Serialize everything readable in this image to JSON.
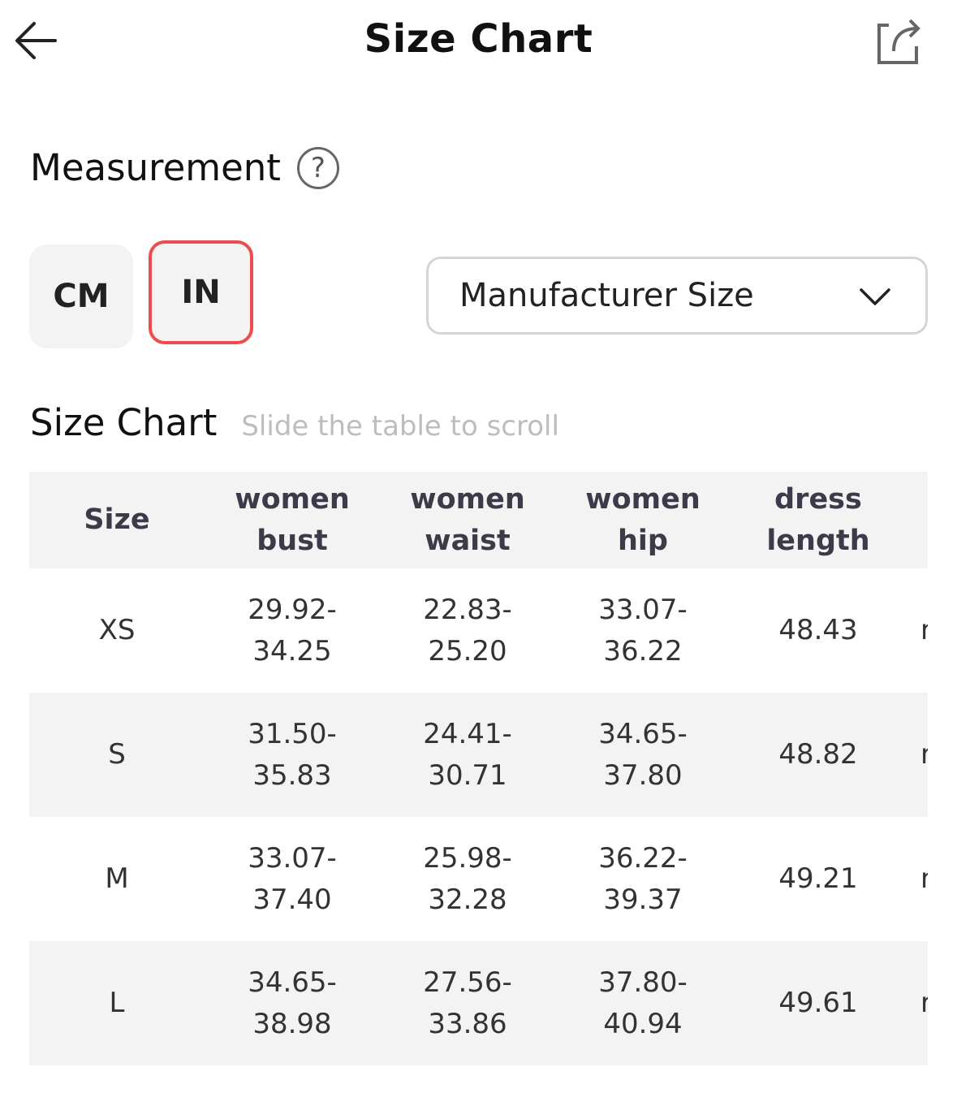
{
  "header": {
    "title": "Size Chart",
    "back_icon": "arrow-left-icon",
    "share_icon": "share-icon"
  },
  "measurement": {
    "title": "Measurement",
    "help_icon": "question-circle-icon",
    "help_glyph": "?",
    "units": [
      "CM",
      "IN"
    ],
    "selected_unit": "IN",
    "accent_color": "#ee4b4f"
  },
  "dropdown": {
    "value": "Manufacturer Size",
    "icon": "chevron-down-icon"
  },
  "size_chart": {
    "title": "Size Chart",
    "hint": "Slide the table to scroll",
    "columns": [
      "Size",
      "women\nbust",
      "women\nwaist",
      "women\nhip",
      "dress\nlength",
      ""
    ],
    "rows": [
      [
        "XS",
        "29.92-\n34.25",
        "22.83-\n25.20",
        "33.07-\n36.22",
        "48.43",
        "r"
      ],
      [
        "S",
        "31.50-\n35.83",
        "24.41-\n30.71",
        "34.65-\n37.80",
        "48.82",
        "r"
      ],
      [
        "M",
        "33.07-\n37.40",
        "25.98-\n32.28",
        "36.22-\n39.37",
        "49.21",
        "r"
      ],
      [
        "L",
        "34.65-\n38.98",
        "27.56-\n33.86",
        "37.80-\n40.94",
        "49.61",
        "r"
      ]
    ]
  }
}
